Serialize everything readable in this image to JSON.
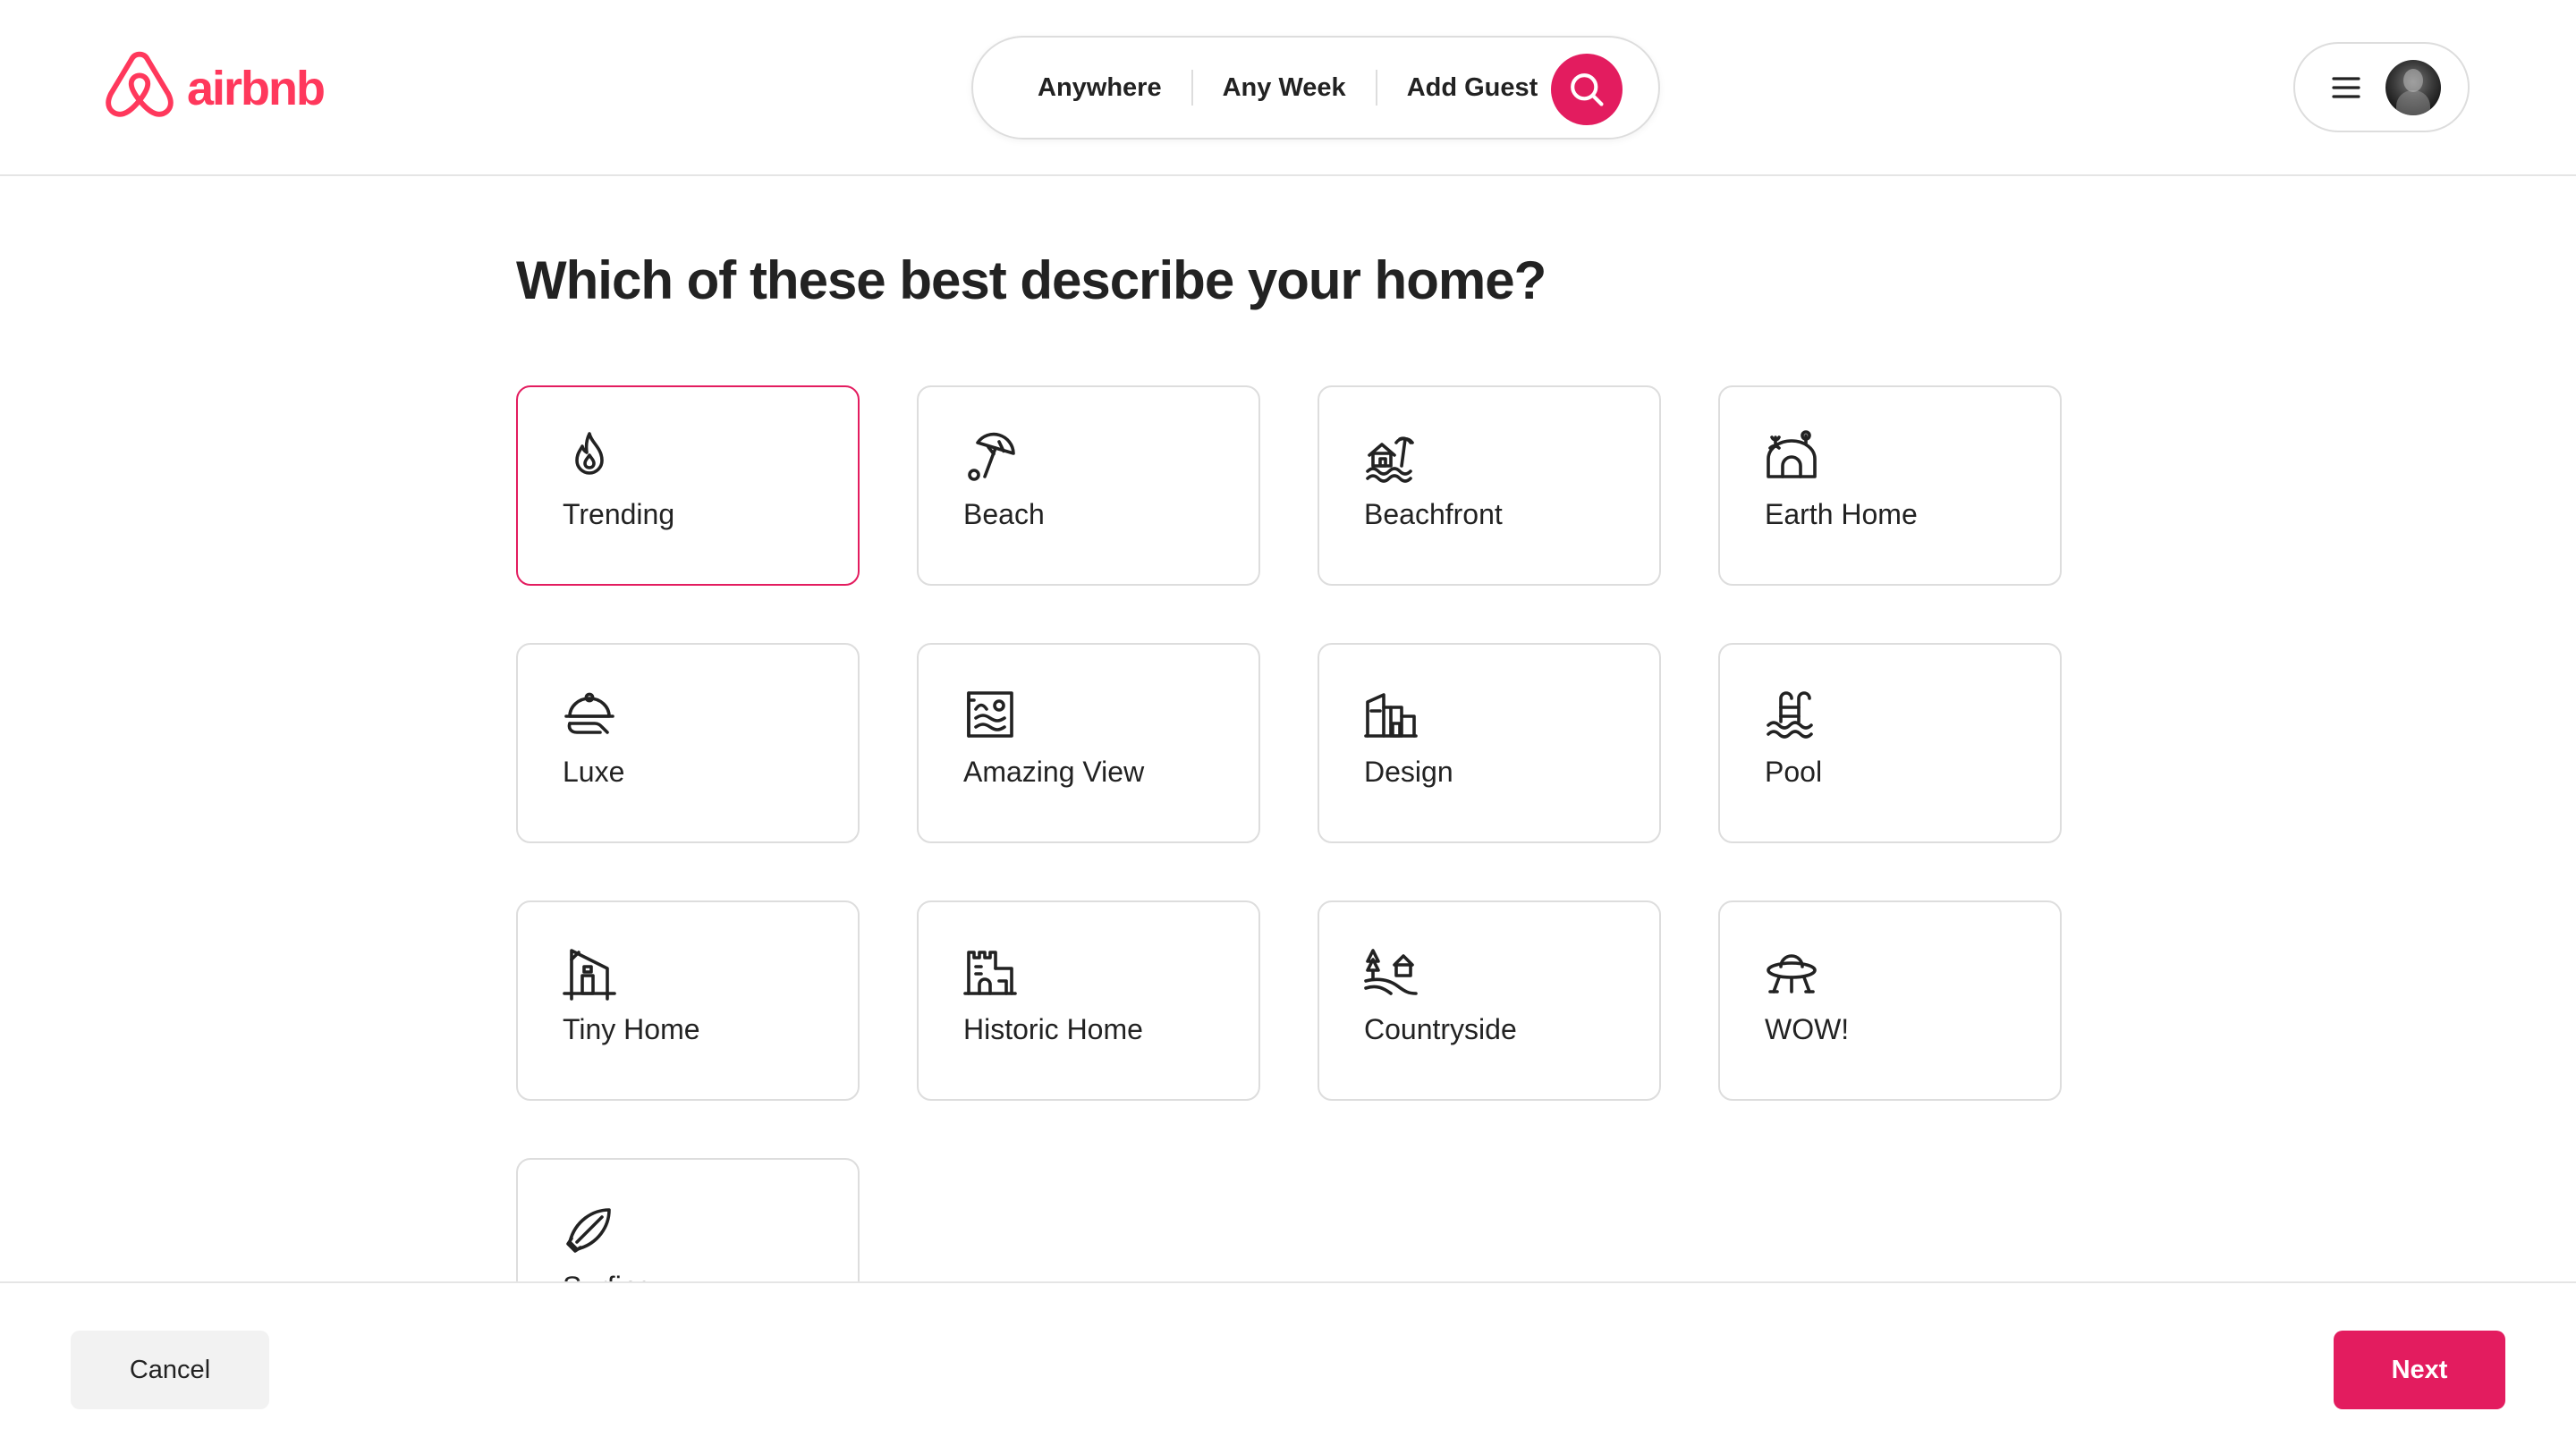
{
  "brand": {
    "name": "airbnb",
    "color": "#ff385c"
  },
  "search": {
    "where": "Anywhere",
    "when": "Any Week",
    "who": "Add Guest",
    "button_color": "#e31c5f",
    "icon": "search-icon"
  },
  "user_menu": {
    "menu_icon": "hamburger-icon",
    "avatar": "user-avatar"
  },
  "main": {
    "title": "Which of these best describe your home?",
    "categories": [
      {
        "label": "Trending",
        "icon": "flame-icon",
        "selected": true
      },
      {
        "label": "Beach",
        "icon": "beach-umbrella-icon",
        "selected": false
      },
      {
        "label": "Beachfront",
        "icon": "beachfront-icon",
        "selected": false
      },
      {
        "label": "Earth Home",
        "icon": "earth-home-icon",
        "selected": false
      },
      {
        "label": "Luxe",
        "icon": "cloche-icon",
        "selected": false
      },
      {
        "label": "Amazing View",
        "icon": "landscape-frame-icon",
        "selected": false
      },
      {
        "label": "Design",
        "icon": "modern-building-icon",
        "selected": false
      },
      {
        "label": "Pool",
        "icon": "pool-ladder-icon",
        "selected": false
      },
      {
        "label": "Tiny Home",
        "icon": "tiny-home-icon",
        "selected": false
      },
      {
        "label": "Historic Home",
        "icon": "castle-icon",
        "selected": false
      },
      {
        "label": "Countryside",
        "icon": "countryside-icon",
        "selected": false
      },
      {
        "label": "WOW!",
        "icon": "ufo-icon",
        "selected": false
      },
      {
        "label": "Surfing",
        "icon": "surfboard-icon",
        "selected": false
      }
    ],
    "selected_color": "#e31c5f"
  },
  "footer": {
    "cancel_label": "Cancel",
    "next_label": "Next",
    "next_color": "#e31c5f"
  }
}
